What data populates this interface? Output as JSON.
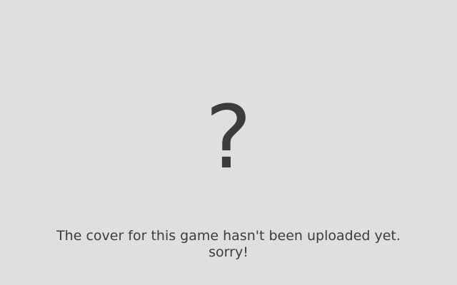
{
  "cover_placeholder": {
    "icon": "question-mark-icon",
    "symbol": "?",
    "message_line_1": "The cover for this game hasn't been uploaded yet.",
    "message_line_2": "sorry!"
  },
  "colors": {
    "background": "#dfdfdf",
    "text": "#3c3c3c"
  }
}
